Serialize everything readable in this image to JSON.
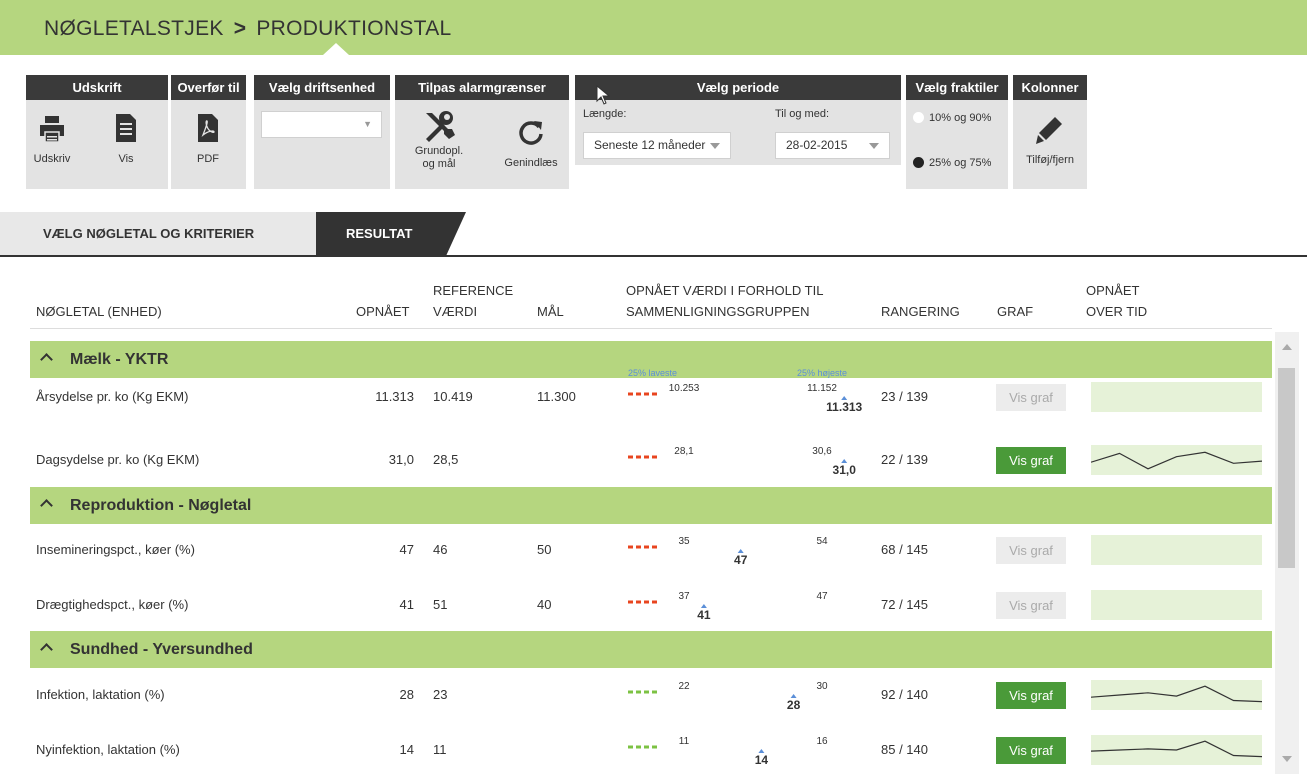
{
  "breadcrumb": {
    "part1": "NØGLETALSTJEK",
    "separator": ">",
    "part2": "PRODUKTIONSTAL"
  },
  "toolbar": {
    "udskrift": {
      "title": "Udskrift",
      "print_label": "Udskriv",
      "view_label": "Vis"
    },
    "overfor": {
      "title": "Overfør til",
      "pdf_label": "PDF"
    },
    "driftsenhed": {
      "title": "Vælg driftsenhed",
      "value": ""
    },
    "alarm": {
      "title": "Tilpas alarmgrænser",
      "grundopl_label": "Grundopl.\nog mål",
      "genindlaes_label": "Genindlæs"
    },
    "periode": {
      "title": "Vælg periode",
      "length_label": "Længde:",
      "length_value": "Seneste 12 måneder",
      "to_label": "Til og med:",
      "to_value": "28-02-2015"
    },
    "fraktiler": {
      "title": "Vælg fraktiler",
      "opt1": "10% og 90%",
      "opt2": "25% og 75%",
      "selected": "25% og 75%"
    },
    "kolonner": {
      "title": "Kolonner",
      "edit_label": "Tilføj/fjern"
    }
  },
  "tabs": [
    {
      "label": "VÆLG NØGLETAL OG KRITERIER",
      "active": false
    },
    {
      "label": "RESULTAT",
      "active": true
    }
  ],
  "columns": {
    "noegletal": "NØGLETAL (ENHED)",
    "opnaaet": "OPNÅET",
    "reference1": "REFERENCE",
    "reference2": "VÆRDI",
    "maal": "MÅL",
    "sammenligning1": "OPNÅET VÆRDI I FORHOLD TIL",
    "sammenligning2": "SAMMENLIGNINGSGRUPPEN",
    "rangering": "RANGERING",
    "graf": "GRAF",
    "overtid1": "OPNÅET",
    "overtid2": "OVER TID"
  },
  "legend": {
    "low": "25% laveste",
    "high": "25% højeste"
  },
  "colors": {
    "green": "#7cc243",
    "red": "#e8451f",
    "header_green": "#b5d67f",
    "button_green": "#4a9a39",
    "legend_blue": "#5b8fd8"
  },
  "groups": [
    {
      "label": "Mælk - YKTR",
      "rows": [
        {
          "name": "Årsydelse pr. ko (Kg EKM)",
          "achieved": "11.313",
          "reference": "10.419",
          "goal": "11.300",
          "low": "10.253",
          "high": "11.152",
          "marker": "11.313",
          "marker_pos": 0.94,
          "direction": "higher-better",
          "rank": "23 / 139",
          "graf": "Vis graf",
          "graf_enabled": false,
          "spark": []
        },
        {
          "name": "Dagsydelse pr. ko (Kg EKM)",
          "achieved": "31,0",
          "reference": "28,5",
          "goal": "",
          "low": "28,1",
          "high": "30,6",
          "marker": "31,0",
          "marker_pos": 0.94,
          "direction": "higher-better",
          "rank": "22 / 139",
          "graf": "Vis graf",
          "graf_enabled": true,
          "spark": [
            0.6,
            0.2,
            0.9,
            0.35,
            0.15,
            0.65,
            0.55
          ]
        }
      ]
    },
    {
      "label": "Reproduktion - Nøgletal",
      "rows": [
        {
          "name": "Insemineringspct., køer (%)",
          "achieved": "47",
          "reference": "46",
          "goal": "50",
          "low": "35",
          "high": "54",
          "marker": "47",
          "marker_pos": 0.49,
          "direction": "higher-better",
          "rank": "68 / 145",
          "graf": "Vis graf",
          "graf_enabled": false,
          "spark": []
        },
        {
          "name": "Drægtighedspct., køer (%)",
          "achieved": "41",
          "reference": "51",
          "goal": "40",
          "low": "37",
          "high": "47",
          "marker": "41",
          "marker_pos": 0.33,
          "direction": "higher-better",
          "rank": "72 / 145",
          "graf": "Vis graf",
          "graf_enabled": false,
          "spark": []
        }
      ]
    },
    {
      "label": "Sundhed - Yversundhed",
      "rows": [
        {
          "name": "Infektion, laktation (%)",
          "achieved": "28",
          "reference": "23",
          "goal": "",
          "low": "22",
          "high": "30",
          "marker": "28",
          "marker_pos": 0.72,
          "direction": "lower-better",
          "rank": "92 / 140",
          "graf": "Vis graf",
          "graf_enabled": true,
          "spark": [
            0.6,
            0.5,
            0.4,
            0.55,
            0.1,
            0.75,
            0.8
          ]
        },
        {
          "name": "Nyinfektion, laktation (%)",
          "achieved": "14",
          "reference": "11",
          "goal": "",
          "low": "11",
          "high": "16",
          "marker": "14",
          "marker_pos": 0.58,
          "direction": "lower-better",
          "rank": "85 / 140",
          "graf": "Vis graf",
          "graf_enabled": true,
          "spark": [
            0.55,
            0.5,
            0.45,
            0.5,
            0.1,
            0.75,
            0.8
          ]
        }
      ]
    }
  ]
}
